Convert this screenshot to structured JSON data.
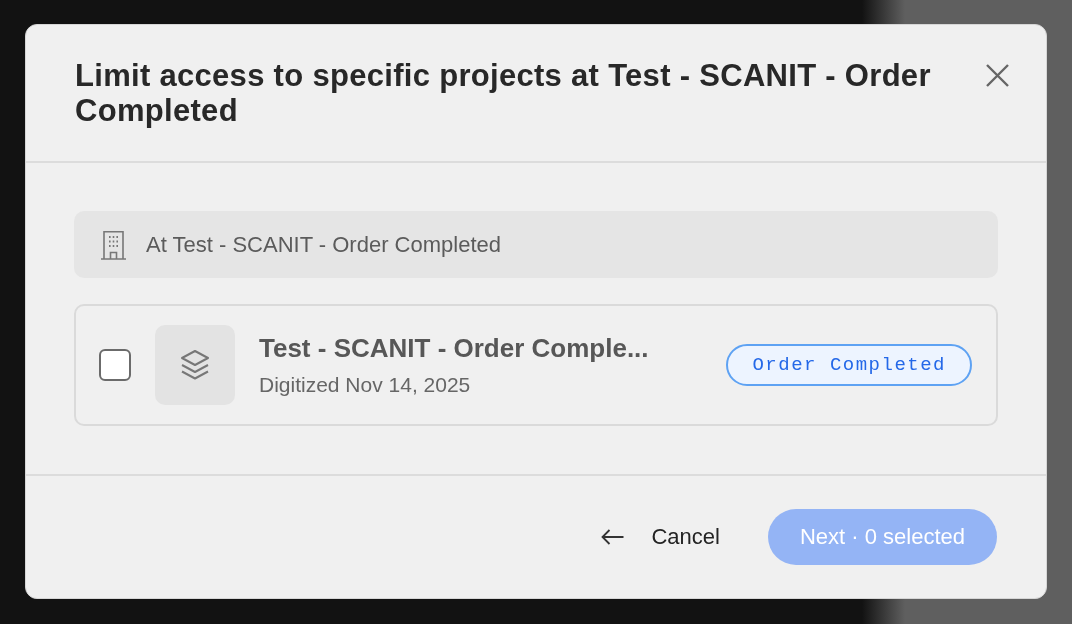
{
  "dialog": {
    "title": "Limit access to specific projects at Test - SCANIT - Order Completed"
  },
  "location": {
    "label": "At Test - SCANIT - Order Completed"
  },
  "projects": [
    {
      "name": "Test - SCANIT - Order Comple...",
      "subtitle": "Digitized Nov 14, 2025",
      "checked": false,
      "status": "Order Completed"
    }
  ],
  "footer": {
    "cancel": "Cancel",
    "next": {
      "label": "Next · 0 selected",
      "disabled": true
    }
  }
}
